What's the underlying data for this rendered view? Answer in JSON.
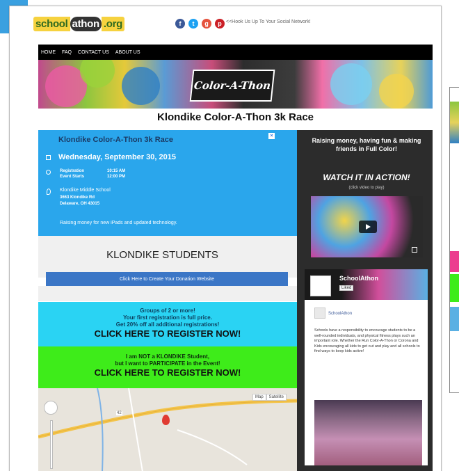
{
  "header": {
    "logo": {
      "part1": "school",
      "part2": "athon",
      "part3": ".org"
    },
    "social": {
      "icons": [
        "facebook-icon",
        "twitter-icon",
        "google-plus-icon",
        "pinterest-icon"
      ],
      "text": "<<Hook Us Up To Your Social Network!"
    }
  },
  "nav": {
    "items": [
      "HOME",
      "FAQ",
      "CONTACT US",
      "ABOUT US"
    ]
  },
  "banner": {
    "logo_text": "Color-A-Thon"
  },
  "page": {
    "title": "Klondike Color-A-Thon 3k Race"
  },
  "event": {
    "title": "Klondike Color-A-Thon 3k Race",
    "date": "Wednesday, September 30, 2015",
    "registration_label": "Registration",
    "registration_time": "10:15 AM",
    "event_starts_label": "Event Starts",
    "event_starts_time": "12:00 PM",
    "location_name": "Klondike Middle School",
    "address_line1": "3663 Klondike Rd",
    "address_line2": "Delaware, OH 43015",
    "note": "Raising money for new iPads and updated technology."
  },
  "students": {
    "title": "KLONDIKE STUDENTS",
    "donation_button": "Click Here to Create Your Donation Website"
  },
  "groups": {
    "line1": "Groups of 2 or more!",
    "line2": "Your first registration is full price.",
    "line3": "Get 20% off all additional registrations!",
    "cta": "CLICK HERE TO REGISTER NOW!"
  },
  "not_student": {
    "line1": "I am NOT a KLONDIKE Student,",
    "line2": "but I want to PARTICIPATE in the Event!",
    "cta": "CLICK HERE TO REGISTER NOW!"
  },
  "map": {
    "map_label": "Map",
    "satellite_label": "Satellite",
    "road_label": "42"
  },
  "sidebar": {
    "tagline": "Raising money, having fun & making friends in Full Color!",
    "watch": "WATCH IT IN ACTION!",
    "click_video": "(click video to play)",
    "fb_page_name": "SchoolAthon",
    "fb_like": "Liked",
    "fb_post_name": "SchoolAthon",
    "fb_post_text": "Schools have a responsibility to encourage students to be a well-rounded individuals, and physical fitness plays such an important role. Whether the Run Color-A-Thon or Corona and Kids encouraging all kids to get out and play and all schools to find ways to keep kids active!"
  },
  "colors": {
    "accent_blue": "#2aa6ec",
    "cyan": "#2ad3f3",
    "green": "#3eec1a",
    "button_blue": "#3b76c6",
    "sidebar": "#2c2c2c"
  }
}
